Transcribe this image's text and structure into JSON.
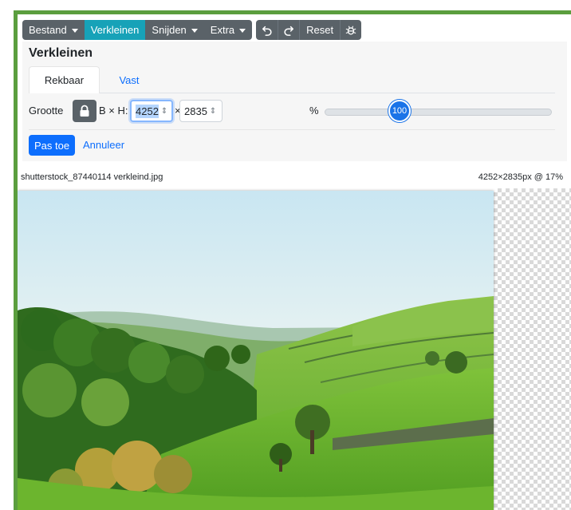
{
  "toolbar": {
    "file_label": "Bestand",
    "resize_label": "Verkleinen",
    "crop_label": "Snijden",
    "extra_label": "Extra",
    "undo_icon": "undo-icon",
    "redo_icon": "redo-icon",
    "reset_label": "Reset",
    "extra_icon": "bug-icon"
  },
  "resize_panel": {
    "title": "Verkleinen",
    "tabs": [
      {
        "label": "Rekbaar",
        "active": true
      },
      {
        "label": "Vast",
        "active": false
      }
    ],
    "size_label": "Grootte",
    "dimension_label": "B × H:",
    "width_value": "4252",
    "times_sign": "×",
    "height_value": "2835",
    "spinner_glyph": "⇕",
    "percent_label": "%",
    "percent_value": "100",
    "apply_label": "Pas toe",
    "cancel_label": "Annuleer"
  },
  "image": {
    "filename": "shutterstock_87440114 verkleind.jpg",
    "info": "4252×2835px @  17%"
  },
  "colors": {
    "frame_border": "#5b9e3e",
    "toolbar_bg": "#5a6268",
    "active_tab": "#17a2b8",
    "primary": "#0d6efd",
    "slider_thumb": "#1a73e8"
  }
}
